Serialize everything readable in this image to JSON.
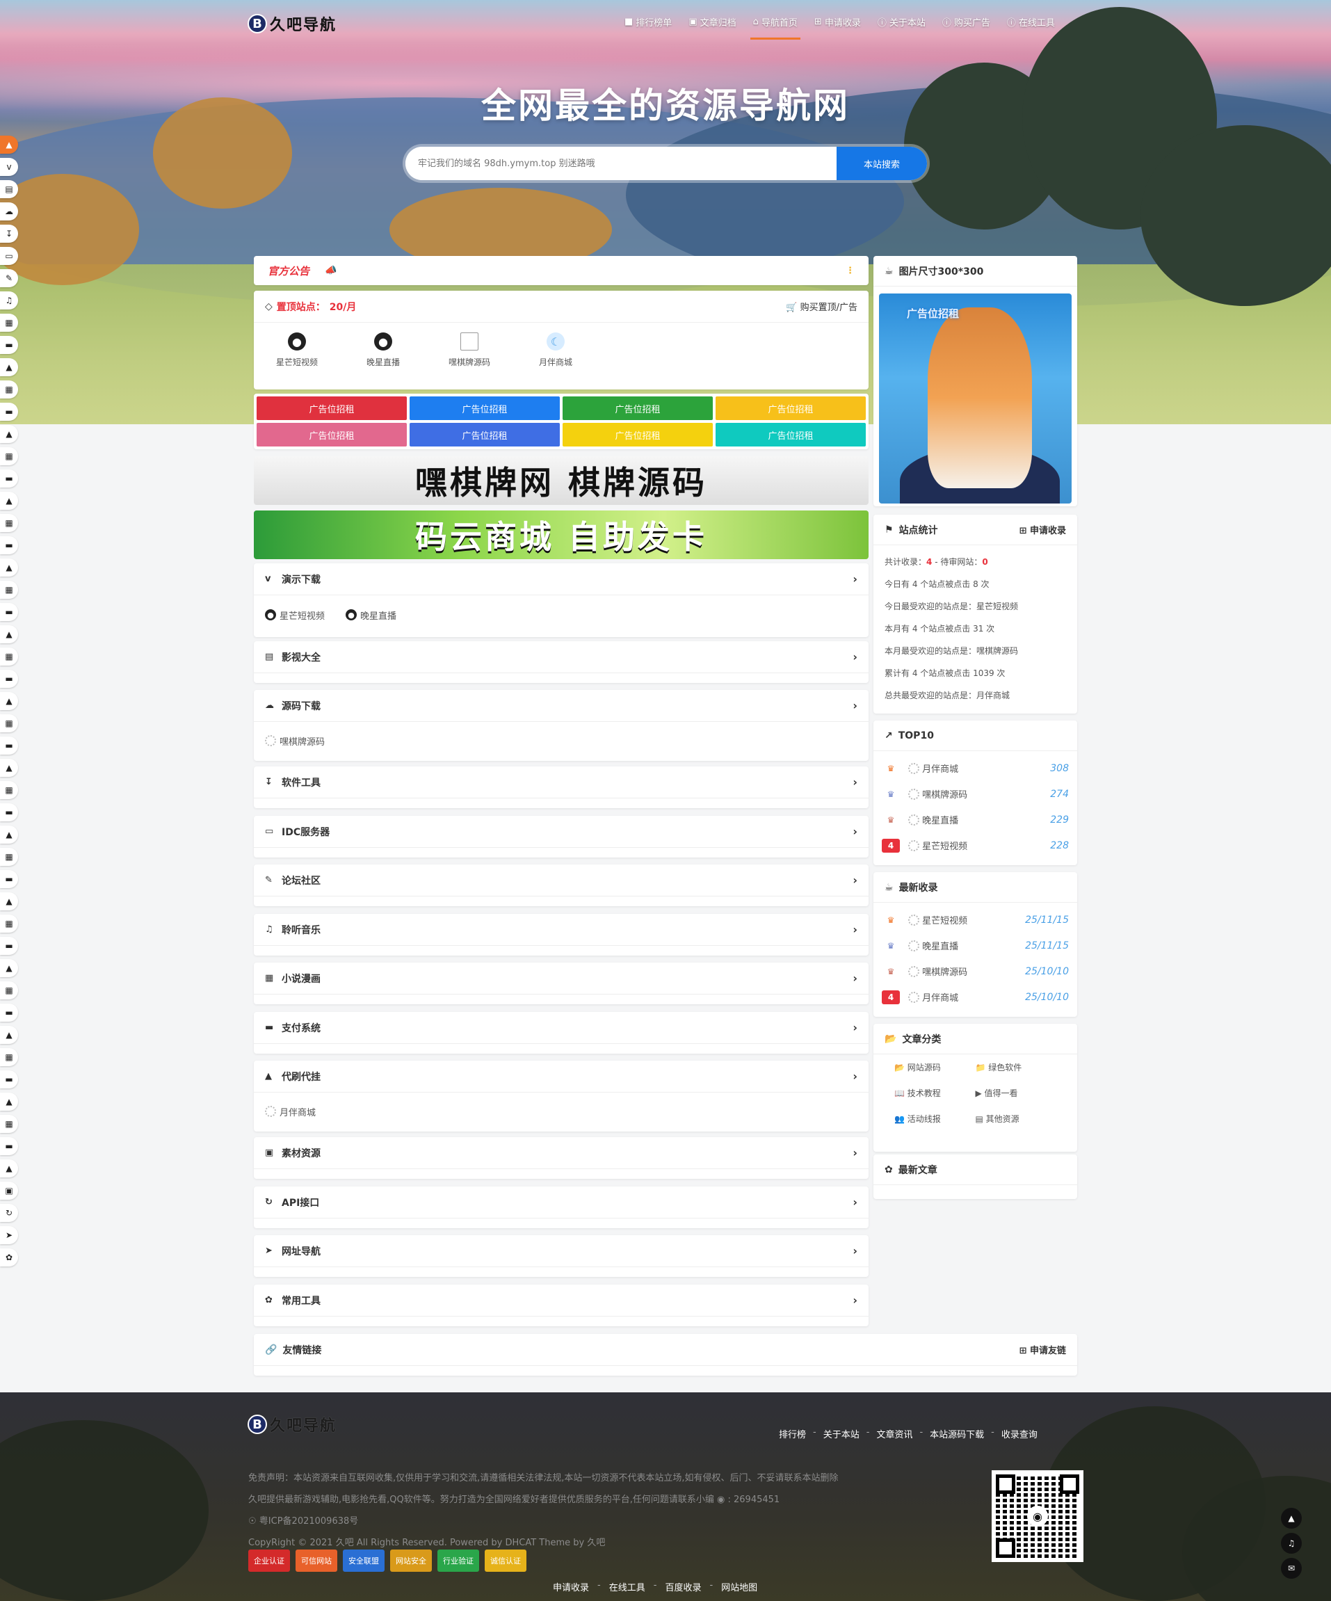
{
  "brand": {
    "logo_mark": "B",
    "logo_text": "久吧导航"
  },
  "nav": [
    {
      "icon": "user-icon",
      "label": "排行榜单"
    },
    {
      "icon": "image-icon",
      "label": "文章归档"
    },
    {
      "icon": "home-icon",
      "label": "导航首页",
      "active": true
    },
    {
      "icon": "plus-icon",
      "label": "申请收录"
    },
    {
      "icon": "info-icon",
      "label": "关于本站"
    },
    {
      "icon": "info-icon",
      "label": "购买广告"
    },
    {
      "icon": "info-icon",
      "label": "在线工具"
    }
  ],
  "hero": {
    "title": "全网最全的资源导航网",
    "search_placeholder": "牢记我们的域名 98dh.ymym.top 别迷路哦",
    "search_button": "本站搜索"
  },
  "announcement": {
    "title": "官方公告"
  },
  "top_sites": {
    "title": "置顶站点：",
    "price": "20/月",
    "buy_label": "购买置顶/广告",
    "items": [
      "星芒短视频",
      "晚星直播",
      "嘿棋牌源码",
      "月伴商城"
    ]
  },
  "ads": {
    "label": "广告位招租",
    "colors": [
      "#e0313e",
      "#1e7ef0",
      "#2ca33b",
      "#f7c01a",
      "#e2688e",
      "#3f6ee4",
      "#f4d10e",
      "#0fcabf"
    ]
  },
  "banners": {
    "b1": "嘿棋牌网 棋牌源码",
    "b2": "码云商城 自助发卡"
  },
  "categories": [
    {
      "icon": "v-icon",
      "title": "演示下载",
      "items": [
        "星芒短视频",
        "晚星直播"
      ],
      "globe": true
    },
    {
      "icon": "file-icon",
      "title": "影视大全",
      "items": []
    },
    {
      "icon": "cloud-icon",
      "title": "源码下载",
      "items": [
        "嘿棋牌源码"
      ]
    },
    {
      "icon": "download-icon",
      "title": "软件工具",
      "items": []
    },
    {
      "icon": "monitor-icon",
      "title": "IDC服务器",
      "items": []
    },
    {
      "icon": "edit-icon",
      "title": "论坛社区",
      "items": []
    },
    {
      "icon": "music-icon",
      "title": "聆听音乐",
      "items": []
    },
    {
      "icon": "book-icon",
      "title": "小说漫画",
      "items": []
    },
    {
      "icon": "card-icon",
      "title": "支付系统",
      "items": []
    },
    {
      "icon": "bag-icon",
      "title": "代刷代挂",
      "items": [
        "月伴商城"
      ]
    },
    {
      "icon": "picture-icon",
      "title": "素材资源",
      "items": []
    },
    {
      "icon": "refresh-icon",
      "title": "API接口",
      "items": []
    },
    {
      "icon": "send-icon",
      "title": "网址导航",
      "items": []
    },
    {
      "icon": "leaf-icon",
      "title": "常用工具",
      "items": []
    }
  ],
  "ad_box": {
    "title": "图片尺寸300*300",
    "image_tag": "广告位招租"
  },
  "stats": {
    "title": "站点统计",
    "apply": "申请收录",
    "total_label": "共计收录：",
    "total": "4",
    "sep": "-",
    "pending_label": "待审网站：",
    "pending": "0",
    "lines": [
      "今日有 4 个站点被点击 8 次",
      "今日最受欢迎的站点是：星芒短视频",
      "本月有 4 个站点被点击 31 次",
      "本月最受欢迎的站点是：嘿棋牌源码",
      "累计有 4 个站点被点击 1039 次",
      "总共最受欢迎的站点是：月伴商城"
    ]
  },
  "top10": {
    "title": "TOP10",
    "rows": [
      {
        "rank": "1",
        "name": "月伴商城",
        "value": "308"
      },
      {
        "rank": "2",
        "name": "嘿棋牌源码",
        "value": "274"
      },
      {
        "rank": "3",
        "name": "晚星直播",
        "value": "229"
      },
      {
        "rank": "4",
        "name": "星芒短视频",
        "value": "228"
      }
    ]
  },
  "latest": {
    "title": "最新收录",
    "rows": [
      {
        "rank": "1",
        "name": "星芒短视频",
        "value": "25/11/15"
      },
      {
        "rank": "2",
        "name": "晚星直播",
        "value": "25/11/15"
      },
      {
        "rank": "3",
        "name": "嘿棋牌源码",
        "value": "25/10/10"
      },
      {
        "rank": "4",
        "name": "月伴商城",
        "value": "25/10/10"
      }
    ]
  },
  "article_cats": {
    "title": "文章分类",
    "items": [
      "网站源码",
      "绿色软件",
      "技术教程",
      "值得一看",
      "活动线报",
      "其他资源"
    ]
  },
  "latest_articles": {
    "title": "最新文章"
  },
  "friend": {
    "title": "友情链接",
    "apply": "申请友链"
  },
  "footer": {
    "nav": [
      "排行榜",
      "关于本站",
      "文章资讯",
      "本站源码下载",
      "收录查询"
    ],
    "disclaimer": "免责声明：本站资源来自互联网收集,仅供用于学习和交流,请遵循相关法律法规,本站一切资源不代表本站立场,如有侵权、后门、不妥请联系本站删除",
    "line2": "久吧提供最新游戏辅助,电影抢先看,QQ软件等。努力打造为全国网络爱好者提供优质服务的平台,任何问题请联系小编",
    "qq": "26945451",
    "icp": "粤ICP备2021009638号",
    "copyright": "CopyRight © 2021 久吧 All Rights Reserved. Powered by DHCAT Theme by 久吧",
    "seals": [
      "企业认证",
      "可信网站",
      "安全联盟",
      "网站安全",
      "行业验证",
      "诚信认证"
    ],
    "nav2": [
      "申请收录",
      "在线工具",
      "百度收录",
      "网站地图"
    ]
  }
}
